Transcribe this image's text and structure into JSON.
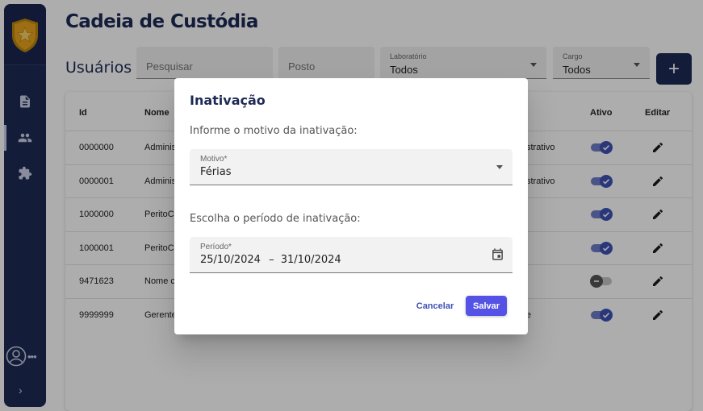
{
  "header": {
    "title": "Cadeia de Custódia",
    "subtitle": "Usuários"
  },
  "filters": {
    "search_placeholder": "Pesquisar",
    "posto_placeholder": "Posto",
    "laboratorio_label": "Laboratório",
    "laboratorio_value": "Todos",
    "cargo_label": "Cargo",
    "cargo_value": "Todos",
    "add_label": "+"
  },
  "sidebar": {
    "items": [
      {
        "icon": "document-icon"
      },
      {
        "icon": "people-icon",
        "active": true
      },
      {
        "icon": "puzzle-icon"
      }
    ],
    "user_dots": "•••",
    "expand_label": "›"
  },
  "table": {
    "columns": [
      "Id",
      "Nome",
      "Ativo",
      "Editar"
    ],
    "rows": [
      {
        "id": "0000000",
        "nome": "Adminis",
        "cargo": "strativo",
        "ativo": true
      },
      {
        "id": "0000001",
        "nome": "Adminis",
        "cargo": "strativo",
        "ativo": true
      },
      {
        "id": "1000000",
        "nome": "PeritoC",
        "cargo": "",
        "ativo": true
      },
      {
        "id": "1000001",
        "nome": "PeritoC",
        "cargo": "",
        "ativo": true
      },
      {
        "id": "9471623",
        "nome": "Nome c",
        "cargo": "",
        "ativo": false
      },
      {
        "id": "9999999",
        "nome": "Gerente",
        "cargo": "e",
        "ativo": true
      }
    ]
  },
  "dialog": {
    "title": "Inativação",
    "reason_prompt": "Informe o motivo da inativação:",
    "motivo_label": "Motivo*",
    "motivo_value": "Férias",
    "period_prompt": "Escolha o período de inativação:",
    "periodo_label": "Período*",
    "periodo_start": "25/10/2024",
    "periodo_sep": "–",
    "periodo_end": "31/10/2024",
    "cancel_label": "Cancelar",
    "save_label": "Salvar"
  },
  "colors": {
    "brand": "#1d2a55",
    "accent": "#3f51b5",
    "save": "#5453e5",
    "badge_gold": "#e8a21c"
  }
}
